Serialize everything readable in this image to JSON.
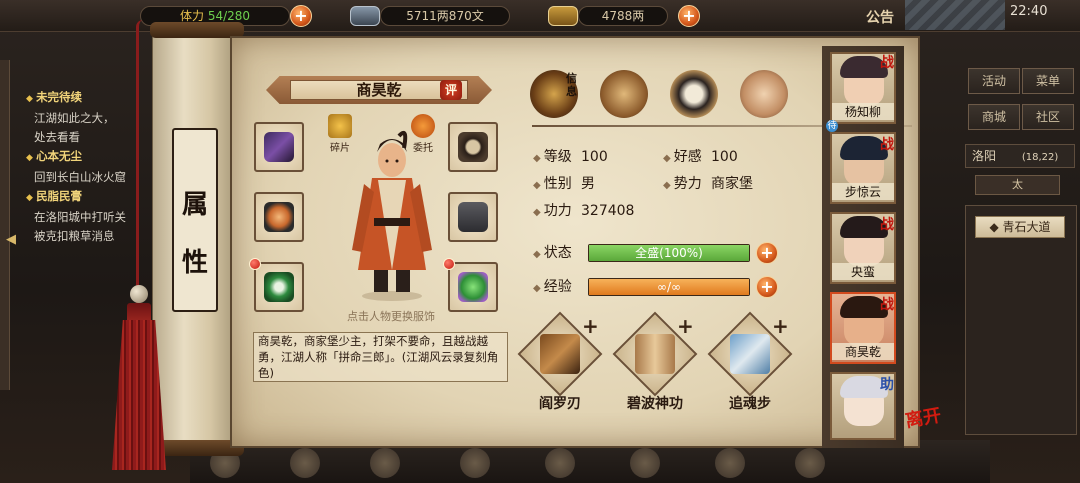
{
  "topbar": {
    "stamina": "54/280",
    "stamina_prefix": "体力",
    "money": "5711两870文",
    "gold": "4788两",
    "notice": "公告",
    "time": "22:40"
  },
  "quests": [
    {
      "title": "未完待续",
      "lines": [
        "江湖如此之大，",
        "处去看看"
      ]
    },
    {
      "title": "心本无尘",
      "lines": [
        "回到长白山冰火窟"
      ]
    },
    {
      "title": "民脂民膏",
      "lines": [
        "在洛阳城中打听关",
        "被克扣粮草消息"
      ]
    }
  ],
  "scroll_label": [
    "属",
    "性"
  ],
  "character": {
    "name": "商昊乾",
    "rate_badge": "评",
    "fragment_label": "碎片",
    "entrust_label": "委托",
    "tip": "点击人物更换服饰",
    "description": "商昊乾，商家堡少主，打架不要命，且越战越勇，江湖人称「拼命三郎」。(江湖风云录复刻角色)"
  },
  "tabs": {
    "info_label": "信息"
  },
  "stats": {
    "level_label": "等级",
    "level": "100",
    "favor_label": "好感",
    "favor": "100",
    "gender_label": "性别",
    "gender": "男",
    "faction_label": "势力",
    "faction": "商家堡",
    "power_label": "功力",
    "power": "327408",
    "status_label": "状态",
    "status_value": "全盛(100%)",
    "status_fill": 1.0,
    "exp_label": "经验",
    "exp_value": "∞/∞",
    "exp_fill": 1.0
  },
  "skills": [
    {
      "name": "阎罗刃",
      "plus": "+"
    },
    {
      "name": "碧波神功",
      "plus": "+"
    },
    {
      "name": "追魂步",
      "plus": "+"
    }
  ],
  "party": [
    {
      "name": "杨知柳",
      "tag": "战",
      "extra": "待"
    },
    {
      "name": "步惊云",
      "tag": "战"
    },
    {
      "name": "央蛮",
      "tag": "战"
    },
    {
      "name": "商昊乾",
      "tag": "战"
    },
    {
      "name": "",
      "tag": "助"
    }
  ],
  "leave": "离开",
  "right_menu": {
    "activity": "活动",
    "menu": "菜单",
    "shop": "商城",
    "community": "社区",
    "location": "洛阳",
    "coords": "(18,22)",
    "sub": "太",
    "road": "青石大道"
  },
  "colors": {
    "status_bar": "#5aa83a",
    "exp_bar": "#e07a1e",
    "accent_red": "#c1170e",
    "parchment": "#e2d4b4"
  }
}
